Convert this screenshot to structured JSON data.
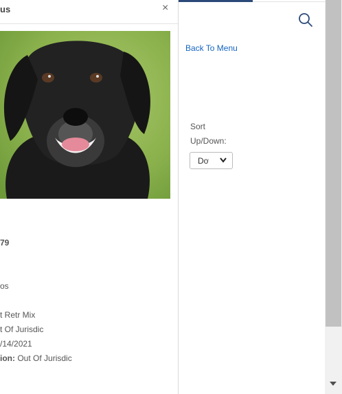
{
  "modal": {
    "title": "us",
    "close_label": "×",
    "details": [
      "79",
      "os",
      "t Retr Mix",
      "t Of Jurisdic",
      "/14/2021"
    ],
    "location_label": "ion:",
    "location_value": "Out Of Jurisdic"
  },
  "right_panel": {
    "back_link": "Back To Menu",
    "sort_label_line1": "Sort",
    "sort_label_line2": "Up/Down:",
    "sort_select_value": "Down"
  },
  "icons": {
    "search": "search-icon",
    "close": "close-icon",
    "dropdown": "chevron-down-icon",
    "scroll_down": "scroll-down-arrow-icon"
  },
  "colors": {
    "link": "#1565c0",
    "tab_indicator": "#2b4a78",
    "scrollbar_thumb": "#c1c1c1"
  }
}
